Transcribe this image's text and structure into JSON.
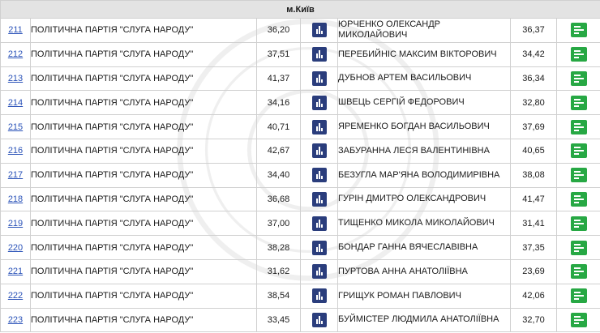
{
  "region": "м.Київ",
  "colors": {
    "chart_button": "#2a3d7c",
    "list_button": "#27a844",
    "link": "#2a52b8",
    "header_bg": "#e3e3e3"
  },
  "rows": [
    {
      "district": "211",
      "party": "ПОЛІТИЧНА ПАРТІЯ \"СЛУГА НАРОДУ\"",
      "party_pct": "36,20",
      "candidate": "ЮРЧЕНКО ОЛЕКСАНДР МИКОЛАЙОВИЧ",
      "candidate_pct": "36,37"
    },
    {
      "district": "212",
      "party": "ПОЛІТИЧНА ПАРТІЯ \"СЛУГА НАРОДУ\"",
      "party_pct": "37,51",
      "candidate": "ПЕРЕБИЙНІС МАКСИМ ВІКТОРОВИЧ",
      "candidate_pct": "34,42"
    },
    {
      "district": "213",
      "party": "ПОЛІТИЧНА ПАРТІЯ \"СЛУГА НАРОДУ\"",
      "party_pct": "41,37",
      "candidate": "ДУБНОВ АРТЕМ ВАСИЛЬОВИЧ",
      "candidate_pct": "36,34"
    },
    {
      "district": "214",
      "party": "ПОЛІТИЧНА ПАРТІЯ \"СЛУГА НАРОДУ\"",
      "party_pct": "34,16",
      "candidate": "ШВЕЦЬ СЕРГІЙ ФЕДОРОВИЧ",
      "candidate_pct": "32,80"
    },
    {
      "district": "215",
      "party": "ПОЛІТИЧНА ПАРТІЯ \"СЛУГА НАРОДУ\"",
      "party_pct": "40,71",
      "candidate": "ЯРЕМЕНКО БОГДАН ВАСИЛЬОВИЧ",
      "candidate_pct": "37,69"
    },
    {
      "district": "216",
      "party": "ПОЛІТИЧНА ПАРТІЯ \"СЛУГА НАРОДУ\"",
      "party_pct": "42,67",
      "candidate": "ЗАБУРАННА ЛЕСЯ ВАЛЕНТИНІВНА",
      "candidate_pct": "40,65"
    },
    {
      "district": "217",
      "party": "ПОЛІТИЧНА ПАРТІЯ \"СЛУГА НАРОДУ\"",
      "party_pct": "34,40",
      "candidate": "БЕЗУГЛА МАР'ЯНА ВОЛОДИМИРІВНА",
      "candidate_pct": "38,08"
    },
    {
      "district": "218",
      "party": "ПОЛІТИЧНА ПАРТІЯ \"СЛУГА НАРОДУ\"",
      "party_pct": "36,68",
      "candidate": "ГУРІН ДМИТРО ОЛЕКСАНДРОВИЧ",
      "candidate_pct": "41,47"
    },
    {
      "district": "219",
      "party": "ПОЛІТИЧНА ПАРТІЯ \"СЛУГА НАРОДУ\"",
      "party_pct": "37,00",
      "candidate": "ТИЩЕНКО МИКОЛА МИКОЛАЙОВИЧ",
      "candidate_pct": "31,41"
    },
    {
      "district": "220",
      "party": "ПОЛІТИЧНА ПАРТІЯ \"СЛУГА НАРОДУ\"",
      "party_pct": "38,28",
      "candidate": "БОНДАР ГАННА ВЯЧЕСЛАВІВНА",
      "candidate_pct": "37,35"
    },
    {
      "district": "221",
      "party": "ПОЛІТИЧНА ПАРТІЯ \"СЛУГА НАРОДУ\"",
      "party_pct": "31,62",
      "candidate": "ПУРТОВА АННА АНАТОЛІЇВНА",
      "candidate_pct": "23,69"
    },
    {
      "district": "222",
      "party": "ПОЛІТИЧНА ПАРТІЯ \"СЛУГА НАРОДУ\"",
      "party_pct": "38,54",
      "candidate": "ГРИЩУК РОМАН ПАВЛОВИЧ",
      "candidate_pct": "42,06"
    },
    {
      "district": "223",
      "party": "ПОЛІТИЧНА ПАРТІЯ \"СЛУГА НАРОДУ\"",
      "party_pct": "33,45",
      "candidate": "БУЙМІСТЕР ЛЮДМИЛА АНАТОЛІЇВНА",
      "candidate_pct": "32,70"
    }
  ]
}
